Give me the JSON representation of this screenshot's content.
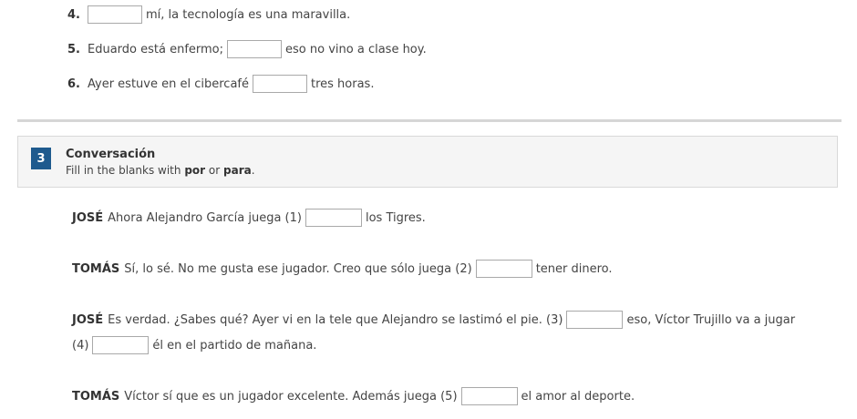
{
  "exercise2": {
    "items": [
      {
        "num": "4.",
        "before": "",
        "after": "mí, la tecnología es una maravilla."
      },
      {
        "num": "5.",
        "before": "Eduardo está enfermo;",
        "after": "eso no vino a clase hoy."
      },
      {
        "num": "6.",
        "before": "Ayer estuve en el cibercafé",
        "after": "tres horas."
      }
    ]
  },
  "section3": {
    "badge": "3",
    "title": "Conversación",
    "instr_prefix": "Fill in the blanks with",
    "word_por": "por",
    "instr_or": "or",
    "word_para": "para",
    "instr_suffix": "."
  },
  "conversation": {
    "line1": {
      "speaker": "JOSÉ",
      "before": "Ahora Alejandro García juega (1)",
      "after": "los Tigres."
    },
    "line2": {
      "speaker": "TOMÁS",
      "before": "Sí, lo sé. No me gusta ese jugador. Creo que sólo juega (2)",
      "after": "tener dinero."
    },
    "line3": {
      "speaker": "JOSÉ",
      "before": "Es verdad. ¿Sabes qué? Ayer vi en la tele que Alejandro se lastimó el pie. (3)",
      "after": "eso, Víctor Trujillo va a jugar"
    },
    "line3b": {
      "before": "(4)",
      "after": "él en el partido de mañana."
    },
    "line4": {
      "speaker": "TOMÁS",
      "before": "Víctor sí que es un jugador excelente. Además juega (5)",
      "after": "el amor al deporte."
    }
  }
}
